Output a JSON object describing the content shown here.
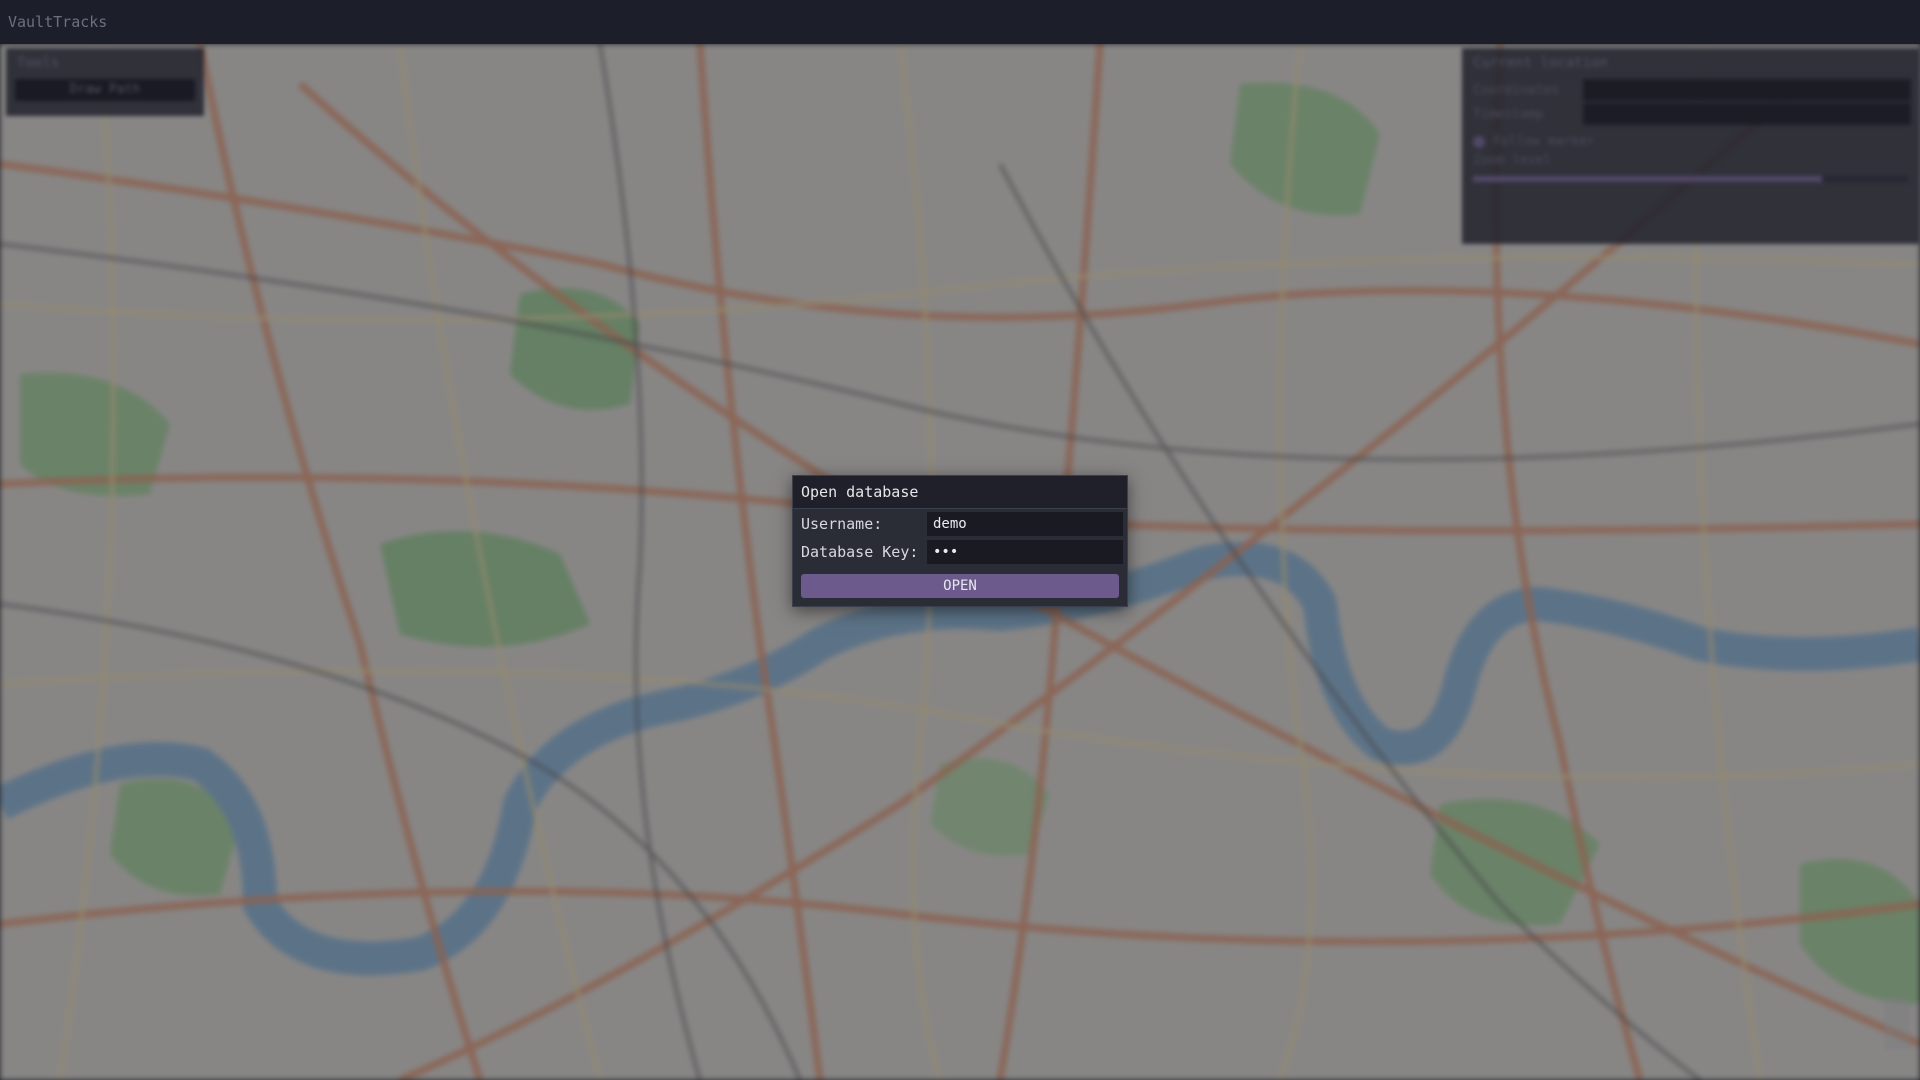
{
  "app": {
    "title": "VaultTracks"
  },
  "tools_panel": {
    "header": "Tools",
    "button_label": "Draw Path"
  },
  "location_panel": {
    "header": "Current location",
    "coordinates_label": "Coordinates",
    "timestamp_label": "Timestamp",
    "follow_label": "Follow marker",
    "zoom_label": "Zoom level",
    "zoom_fraction": 0.8
  },
  "dialog": {
    "title": "Open database",
    "username_label": "Username:",
    "username_value": "demo",
    "key_label": "Database Key:",
    "key_value": "•••",
    "open_label": "OPEN"
  },
  "colors": {
    "accent": "#6c5a8c",
    "titlebar": "#1c1e2a",
    "dialog_bg": "#2a2c36"
  }
}
